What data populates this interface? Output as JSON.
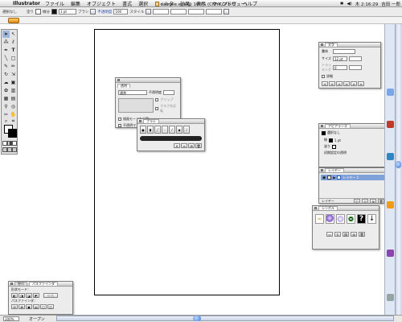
{
  "menubar": {
    "app_name": "Illustrator",
    "items": [
      "ファイル",
      "編集",
      "オブジェクト",
      "書式",
      "選択",
      "フィルタ",
      "効果",
      "表示",
      "ウィンドウ",
      "ヘルプ"
    ],
    "clock": "木 2:16:29",
    "user": "吉田 一郎"
  },
  "controlbar": {
    "selection": "選択なし",
    "stroke_label": "線分",
    "stroke_weight": "1 pt",
    "brush_label": "ブラシ",
    "opacity_label": "不透明度",
    "opacity": "100",
    "style_label": "スタイル"
  },
  "document": {
    "title": "sample.eps @ 100% (CMYK/プレビュー)"
  },
  "transparency_panel": {
    "tab_transparency": "透明",
    "blend_mode": "通常",
    "opacity_label": "不透明度",
    "clip": "クリップ",
    "invert_mask": "マスクを反転",
    "isolate_blending": "描画モードを分離",
    "knockout_group": "不透明マスク"
  },
  "brush_panel": {
    "tab": "ブラシ"
  },
  "character_panel": {
    "tab": "文字",
    "font_label": "書体",
    "size_label": "サイズ",
    "size_value": "12 pt",
    "leading_label": "行送り",
    "tracking_label": "トラッキング",
    "kerning_value": "0",
    "option_label": "詳細"
  },
  "appearance_panel": {
    "tab": "アピアランス",
    "no_selection": "選択なし",
    "stroke_label": "線",
    "stroke_value": "1 pt",
    "fill_label": "塗り",
    "default_transparency": "初期設定の透明"
  },
  "layers_panel": {
    "tab": "レイヤー",
    "layer_name": "レイヤー 1",
    "footer": "レイヤー"
  },
  "symbols_panel": {
    "tab": "シンボル"
  },
  "pathfinder_panel": {
    "tab_align": "整列",
    "tab_pathfinder": "パスファインダ",
    "shape_mode_label": "形状モード：",
    "expand_button": "拡張",
    "pathfinder_label": "パスファインダ："
  },
  "statusbar": {
    "zoom": "100%",
    "tool": "オープン"
  }
}
